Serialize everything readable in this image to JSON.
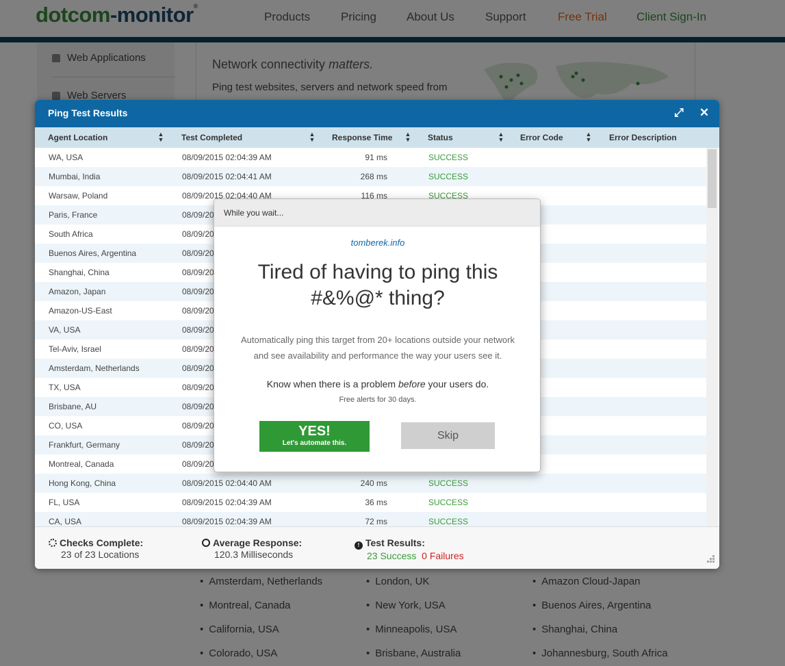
{
  "nav": {
    "logo_green": "dotcom",
    "logo_dark": "-monitor",
    "logo_mark": "®",
    "items": [
      "Products",
      "Pricing",
      "About Us",
      "Support",
      "Free Trial",
      "Client Sign-In"
    ]
  },
  "sidebar": {
    "items": [
      "Web Applications",
      "Web Servers"
    ]
  },
  "hero": {
    "title_plain": "Network connectivity ",
    "title_em": "matters.",
    "subtitle": "Ping test websites, servers and network speed from"
  },
  "locations_list": {
    "col1": [
      "Amsterdam, Netherlands",
      "Montreal, Canada",
      "California, USA",
      "Colorado, USA"
    ],
    "col2": [
      "London, UK",
      "New York, USA",
      "Minneapolis, USA",
      "Brisbane, Australia"
    ],
    "col3": [
      "Amazon Cloud-Japan",
      "Buenos Aires, Argentina",
      "Shanghai, China",
      "Johannesburg, South Africa"
    ]
  },
  "results": {
    "title": "Ping Test Results",
    "columns": [
      "Agent Location",
      "Test Completed",
      "Response Time",
      "Status",
      "Error Code",
      "Error Description"
    ],
    "rows": [
      {
        "location": "WA, USA",
        "time": "08/09/2015 02:04:39 AM",
        "response": "91 ms",
        "status": "SUCCESS"
      },
      {
        "location": "Mumbai, India",
        "time": "08/09/2015 02:04:41 AM",
        "response": "268 ms",
        "status": "SUCCESS"
      },
      {
        "location": "Warsaw, Poland",
        "time": "08/09/2015 02:04:40 AM",
        "response": "116 ms",
        "status": "SUCCESS"
      },
      {
        "location": "Paris, France",
        "time": "08/09/20",
        "response": "",
        "status": ""
      },
      {
        "location": "South Africa",
        "time": "08/09/20",
        "response": "",
        "status": ""
      },
      {
        "location": "Buenos Aires, Argentina",
        "time": "08/09/20",
        "response": "",
        "status": ""
      },
      {
        "location": "Shanghai, China",
        "time": "08/09/20",
        "response": "",
        "status": ""
      },
      {
        "location": "Amazon, Japan",
        "time": "08/09/20",
        "response": "",
        "status": ""
      },
      {
        "location": "Amazon-US-East",
        "time": "08/09/20",
        "response": "",
        "status": ""
      },
      {
        "location": "VA, USA",
        "time": "08/09/20",
        "response": "",
        "status": ""
      },
      {
        "location": "Tel-Aviv, Israel",
        "time": "08/09/20",
        "response": "",
        "status": ""
      },
      {
        "location": "Amsterdam, Netherlands",
        "time": "08/09/20",
        "response": "",
        "status": ""
      },
      {
        "location": "TX, USA",
        "time": "08/09/20",
        "response": "",
        "status": ""
      },
      {
        "location": "Brisbane, AU",
        "time": "08/09/20",
        "response": "",
        "status": ""
      },
      {
        "location": "CO, USA",
        "time": "08/09/20",
        "response": "",
        "status": ""
      },
      {
        "location": "Frankfurt, Germany",
        "time": "08/09/20",
        "response": "",
        "status": ""
      },
      {
        "location": "Montreal, Canada",
        "time": "08/09/20",
        "response": "",
        "status": ""
      },
      {
        "location": "Hong Kong, China",
        "time": "08/09/2015 02:04:40 AM",
        "response": "240 ms",
        "status": "SUCCESS"
      },
      {
        "location": "FL, USA",
        "time": "08/09/2015 02:04:39 AM",
        "response": "36 ms",
        "status": "SUCCESS"
      },
      {
        "location": "CA, USA",
        "time": "08/09/2015 02:04:39 AM",
        "response": "72 ms",
        "status": "SUCCESS"
      }
    ],
    "footer": {
      "checks_label": "Checks Complete:",
      "checks_value": "23 of 23 Locations",
      "avg_label": "Average Response:",
      "avg_value": "120.3 Milliseconds",
      "results_label": "Test Results:",
      "success_text": "23 Success",
      "failure_text": "0 Failures"
    }
  },
  "popup": {
    "bar_text": "While you wait...",
    "domain": "tomberek.info",
    "headline_line1": "Tired of having to ping this",
    "headline_line2": "#&%@* thing?",
    "body_line1": "Automatically ping this target from 20+ locations outside your network",
    "body_line2": "and see availability and performance the way your users see it.",
    "know_before": "Know when there is a problem ",
    "know_em": "before",
    "know_after": " your users do.",
    "free_text": "Free alerts for 30 days.",
    "yes_label": "YES!",
    "yes_sub": "Let's automate this.",
    "skip_label": "Skip"
  },
  "colors": {
    "brand_blue": "#0e67a3",
    "brand_green": "#3a8a3a",
    "success_green": "#3a9a3a",
    "failure_red": "#cc2222",
    "trial_orange": "#e06b1f"
  }
}
